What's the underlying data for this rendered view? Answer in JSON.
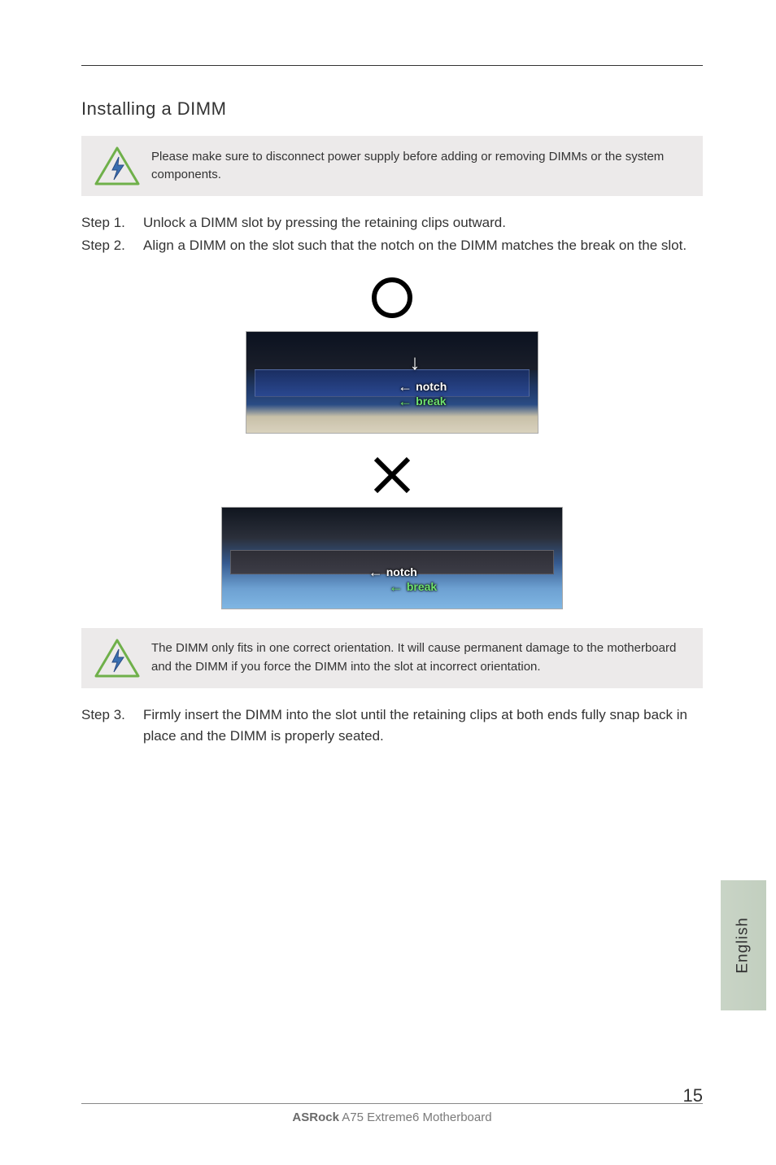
{
  "section_title": "Installing a DIMM",
  "callout1": "Please make sure to disconnect power supply before adding or removing DIMMs or the system components.",
  "steps": {
    "s1_label": "Step 1.",
    "s1_body": "Unlock a DIMM slot by pressing the retaining clips outward.",
    "s2_label": "Step 2.",
    "s2_body": "Align a DIMM on the slot such that the notch on the DIMM matches the break on the slot.",
    "s3_label": "Step 3.",
    "s3_body": "Firmly insert the DIMM into the slot until the retaining clips at both ends fully snap back in place and the DIMM is properly seated."
  },
  "figure": {
    "top_notch": "notch",
    "top_break": "break",
    "bottom_notch": "notch",
    "bottom_break": "break"
  },
  "callout2": "The DIMM only fits in one correct orientation. It will cause permanent damage to the motherboard and the DIMM if you force the DIMM into the slot at incorrect orientation.",
  "language_tab": "English",
  "footer_brand_bold": "ASRock",
  "footer_brand_rest": "  A75 Extreme6  Motherboard",
  "page_number": "15"
}
